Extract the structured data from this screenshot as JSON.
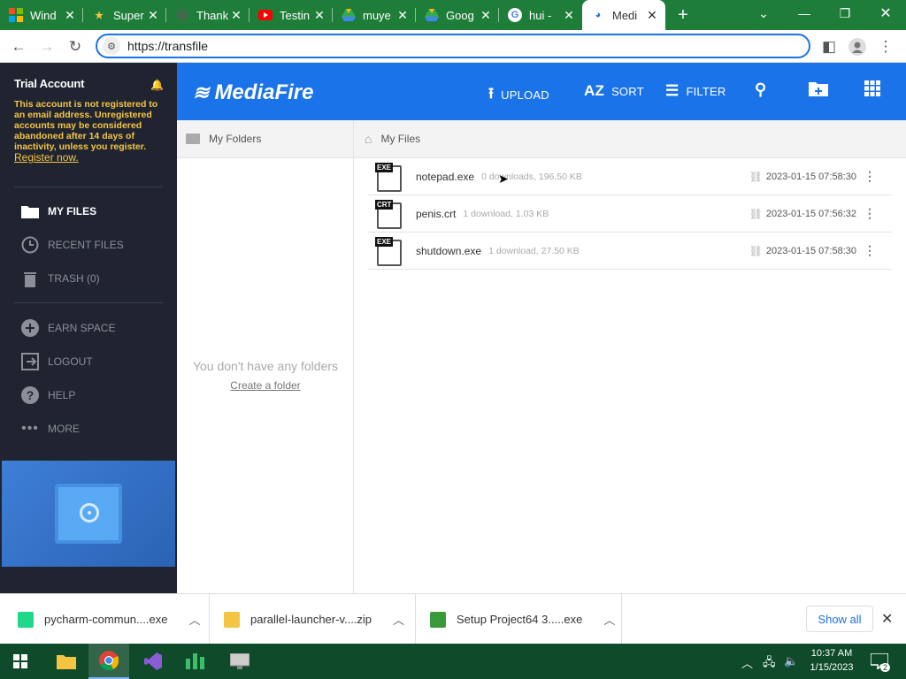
{
  "browser": {
    "tabs": [
      {
        "title": "Wind",
        "icon": "windows-icon",
        "color": "#f25022"
      },
      {
        "title": "Super",
        "icon": "star-icon",
        "color": "#f5c542"
      },
      {
        "title": "Thank",
        "icon": "globe-icon",
        "color": "#888888"
      },
      {
        "title": "Testin",
        "icon": "youtube-icon",
        "color": "#ff0000"
      },
      {
        "title": "muye",
        "icon": "drive-icon",
        "color": "#34a853"
      },
      {
        "title": "Goog",
        "icon": "drive-icon",
        "color": "#34a853"
      },
      {
        "title": "hui -",
        "icon": "google-icon",
        "color": "#4285f4"
      },
      {
        "title": "Medi",
        "icon": "mediafire-icon",
        "color": "#1a73e8",
        "active": true
      }
    ],
    "new_tab": "+",
    "url": "https://transfile"
  },
  "sidebar": {
    "account_title": "Trial Account",
    "warning": "This account is not registered to an email address. Unregistered accounts may be considered abandoned after 14 days of inactivity, unless you register.",
    "register_link": "Register now.",
    "nav": [
      {
        "label": "MY FILES",
        "icon": "folder-icon",
        "active": true
      },
      {
        "label": "RECENT FILES",
        "icon": "clock-icon"
      },
      {
        "label": "TRASH (0)",
        "icon": "trash-icon"
      },
      {
        "label": "EARN SPACE",
        "icon": "plus-circle-icon"
      },
      {
        "label": "LOGOUT",
        "icon": "logout-icon"
      },
      {
        "label": "HELP",
        "icon": "help-icon"
      },
      {
        "label": "MORE",
        "icon": "more-icon"
      }
    ]
  },
  "header": {
    "logo": "MediaFire",
    "upload": "UPLOAD",
    "sort": "SORT",
    "filter": "FILTER",
    "sort_icon_text": "AZ"
  },
  "folders": {
    "title": "My Folders",
    "empty": "You don't have any folders",
    "create": "Create a folder"
  },
  "files": {
    "title": "My Files",
    "rows": [
      {
        "ext": "EXE",
        "name": "notepad.exe",
        "meta": "0 downloads, 196.50 KB",
        "date": "2023-01-15 07:58:30"
      },
      {
        "ext": "CRT",
        "name": "penis.crt",
        "meta": "1 download, 1.03 KB",
        "date": "2023-01-15 07:56:32"
      },
      {
        "ext": "EXE",
        "name": "shutdown.exe",
        "meta": "1 download, 27.50 KB",
        "date": "2023-01-15 07:58:30"
      }
    ]
  },
  "downloads": {
    "items": [
      {
        "name": "pycharm-commun....exe",
        "color": "#21d789"
      },
      {
        "name": "parallel-launcher-v....zip",
        "color": "#f5c542"
      },
      {
        "name": "Setup Project64 3.....exe",
        "color": "#3a9a3a"
      }
    ],
    "show_all": "Show all"
  },
  "taskbar": {
    "time": "10:37 AM",
    "date": "1/15/2023",
    "notification_count": "2"
  }
}
